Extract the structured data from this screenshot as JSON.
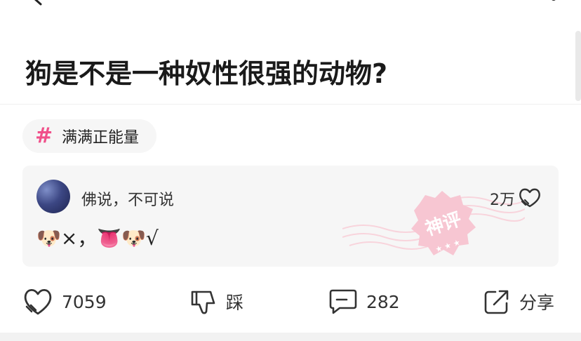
{
  "post": {
    "question_title": "狗是不是一种奴性很强的动物?"
  },
  "topic": {
    "icon": "hashtag-icon",
    "label": "满满正能量",
    "accent_color": "#f0508a"
  },
  "top_comment": {
    "username": "佛说，不可说",
    "like_count": "2万",
    "content": "🐶×，👅🐶√",
    "badge_icon": "god-comment-stamp-icon",
    "badge_text": "神评"
  },
  "actions": {
    "like": {
      "icon": "heart-like-icon",
      "count": "7059"
    },
    "dislike": {
      "icon": "thumbs-down-icon",
      "label": "踩"
    },
    "comment": {
      "icon": "comment-icon",
      "count": "282"
    },
    "share": {
      "icon": "share-icon",
      "label": "分享"
    }
  }
}
